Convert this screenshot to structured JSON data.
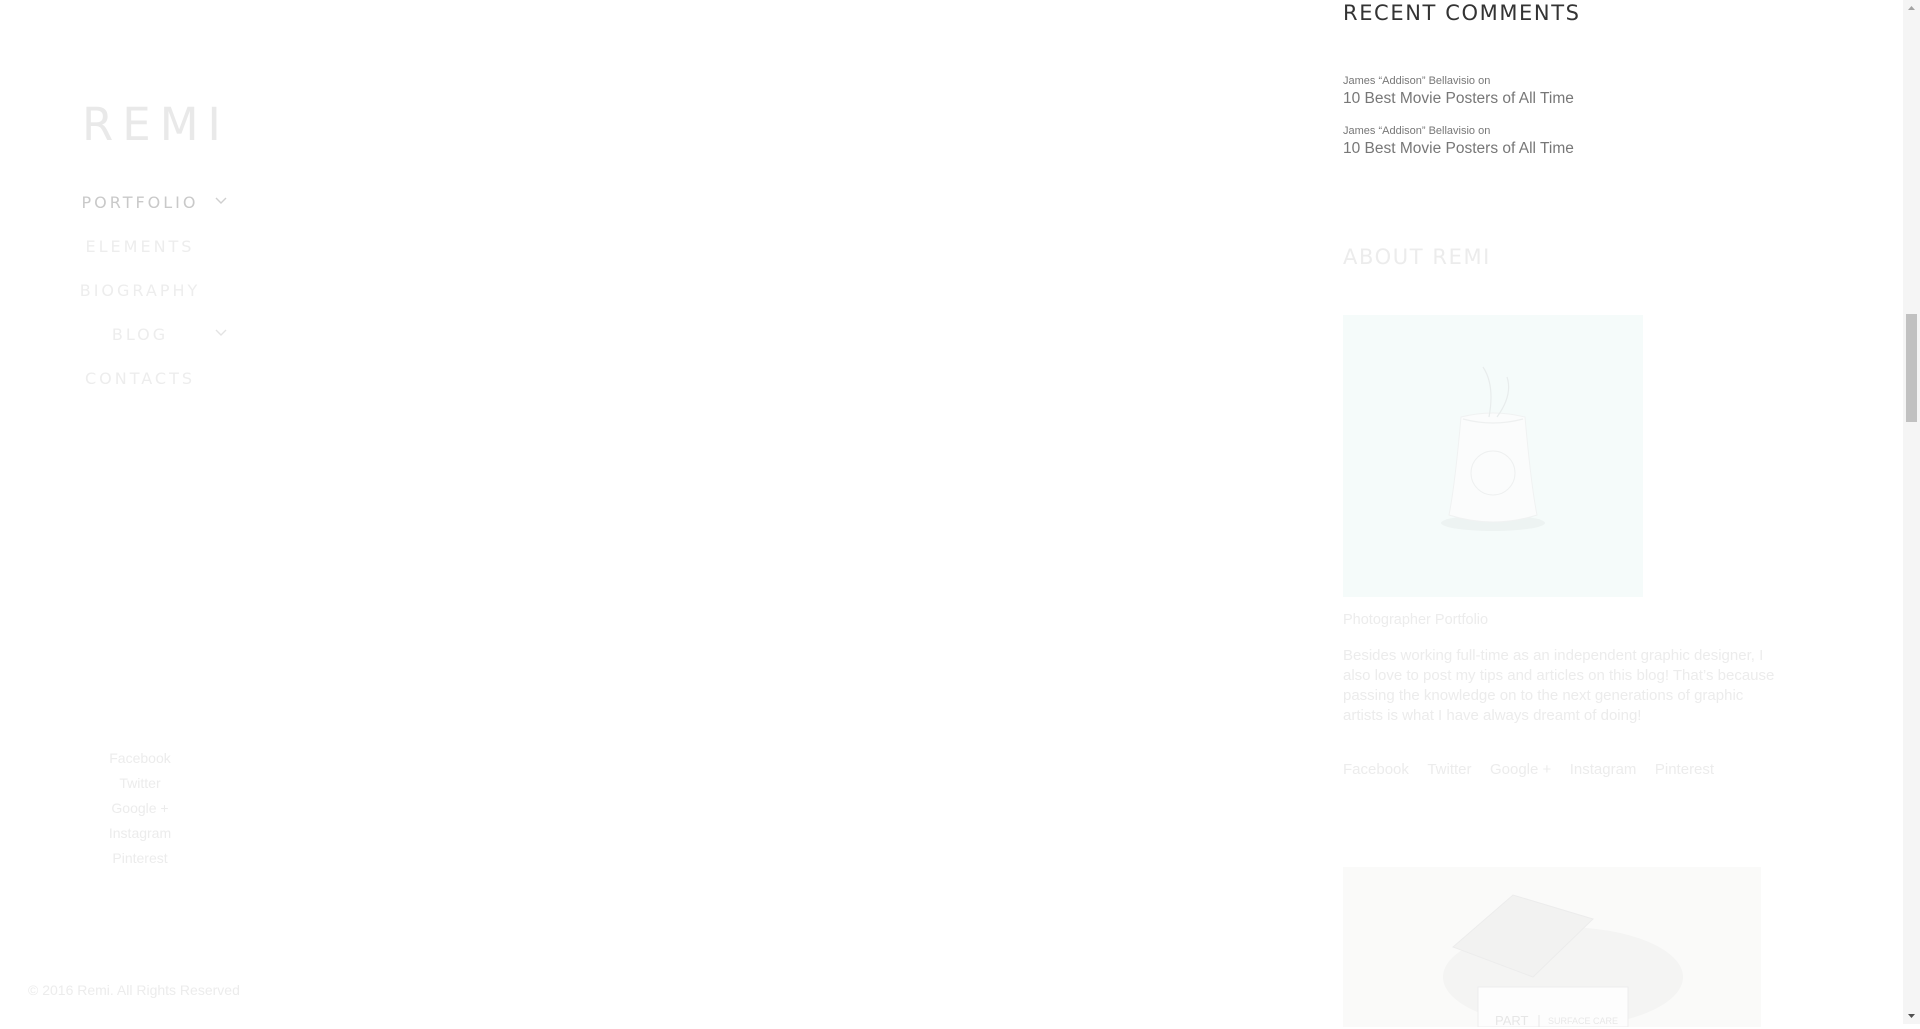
{
  "site": {
    "logo": "REMI",
    "nav": [
      {
        "label": "PORTFOLIO",
        "has_submenu": true
      },
      {
        "label": "ELEMENTS",
        "has_submenu": false
      },
      {
        "label": "BIOGRAPHY",
        "has_submenu": false
      },
      {
        "label": "BLOG",
        "has_submenu": true
      },
      {
        "label": "CONTACTS",
        "has_submenu": false
      }
    ],
    "social": [
      "Facebook",
      "Twitter",
      "Google +",
      "Instagram",
      "Pinterest"
    ],
    "copyright": "© 2016 Remi. All Rights Reserved"
  },
  "widgets": {
    "recent_comments": {
      "title": "RECENT COMMENTS",
      "items": [
        {
          "author": "James “Addison” Bellavisio",
          "on": "on",
          "post": "10 Best Movie Posters of All Time"
        },
        {
          "author": "James “Addison” Bellavisio",
          "on": "on",
          "post": "10 Best Movie Posters of All Time"
        }
      ]
    },
    "about": {
      "title": "ABOUT REMI",
      "caption": "Photographer Portfolio",
      "text": "Besides working full-time as an independent graphic designer, I also love to post my tips and articles on this blog! That’s because passing the knowledge on to the next generations of graphic artists is what I have always dreamt of doing!",
      "social": [
        "Facebook",
        "Twitter",
        "Google +",
        "Instagram",
        "Pinterest"
      ]
    },
    "promo": {
      "label_left": "PART",
      "label_right": "SURFACE CARE"
    }
  },
  "colors": {
    "heading": "#333333",
    "comment_text": "#777777",
    "faded_text": "#ececec",
    "scroll_thumb": "#c1c1c1"
  },
  "icons": {
    "submenu": "chevron-down-icon",
    "scroll_up": "triangle-up-icon",
    "scroll_down": "triangle-down-icon"
  }
}
